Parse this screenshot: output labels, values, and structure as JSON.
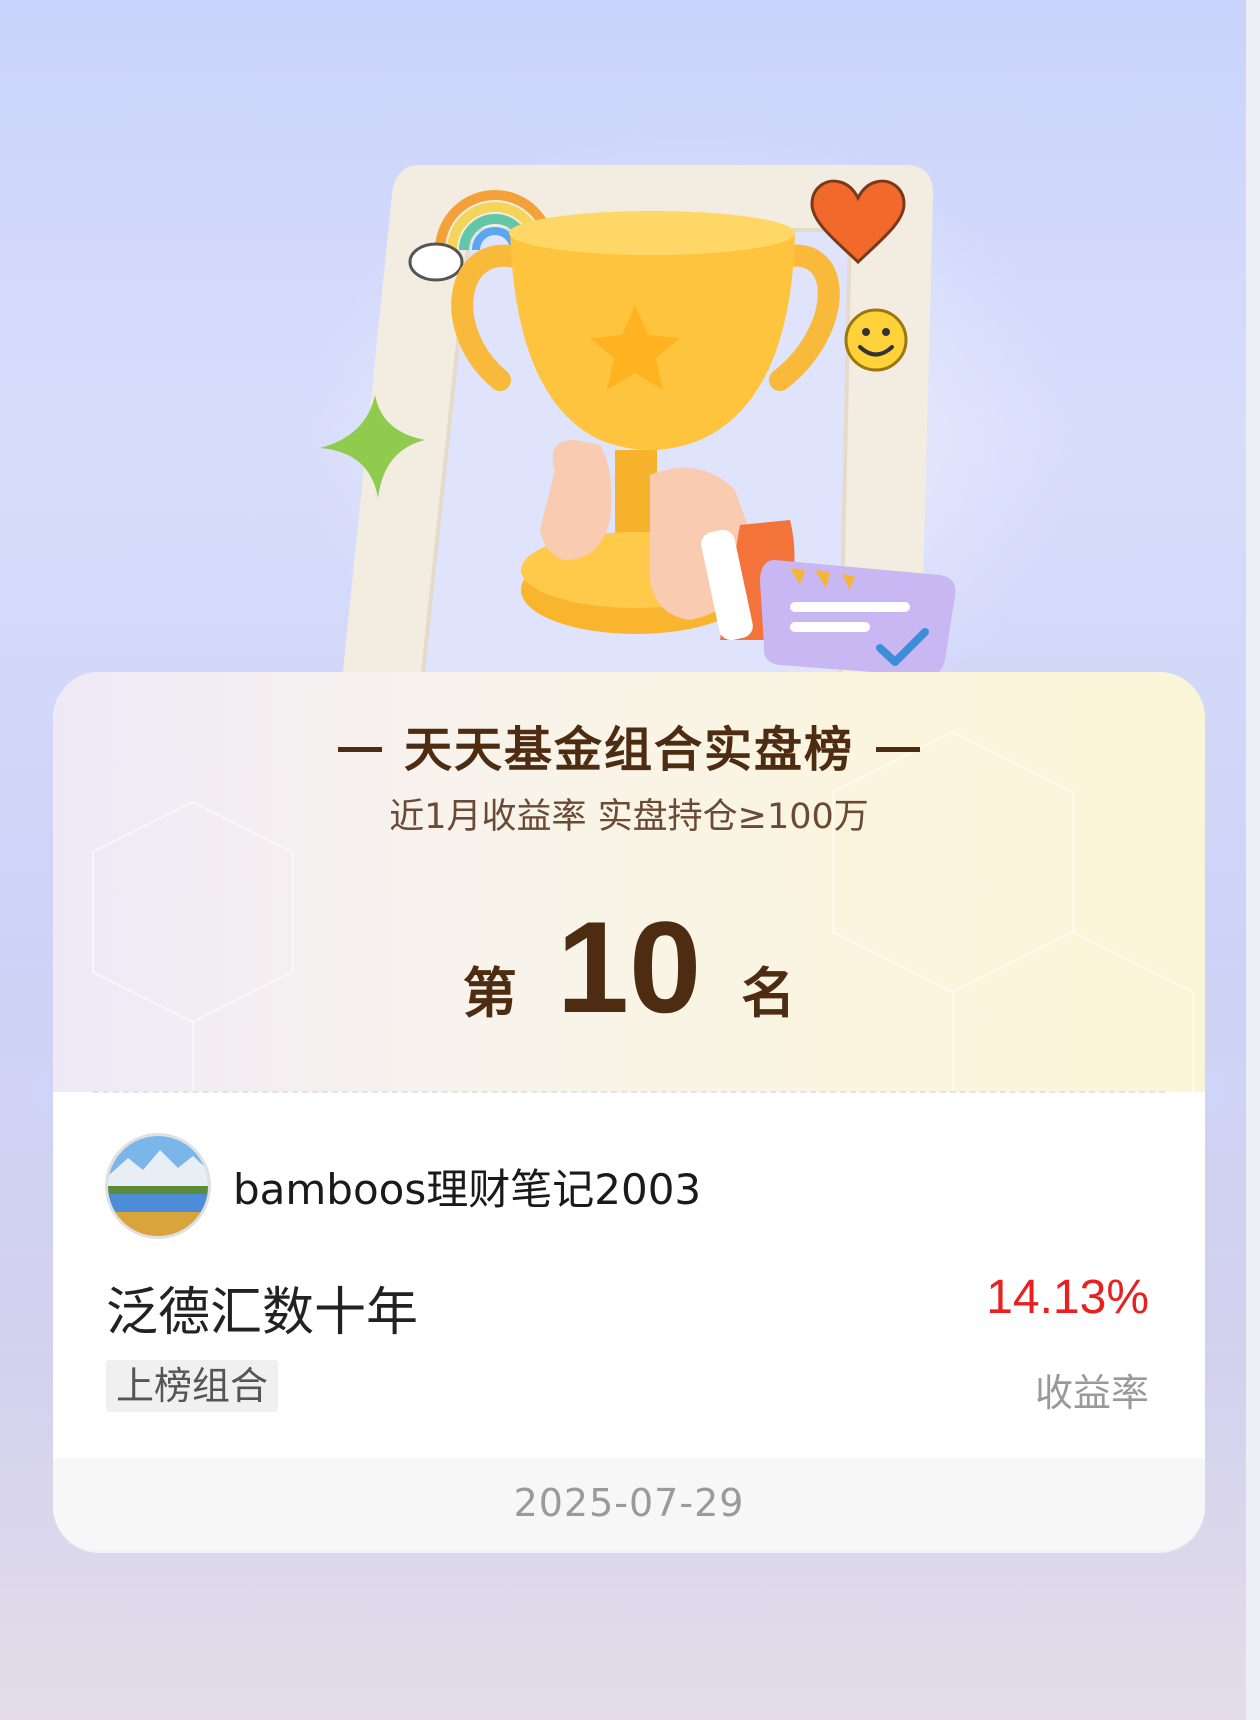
{
  "card": {
    "title": "天天基金组合实盘榜",
    "subtitle": "近1月收益率 实盘持仓≥100万",
    "rank_prefix": "第",
    "rank_number": "10",
    "rank_suffix": "名"
  },
  "user": {
    "name": "bamboos理财笔记2003"
  },
  "fund": {
    "name": "泛德汇数十年",
    "tag": "上榜组合",
    "return_value": "14.13%",
    "return_label": "收益率"
  },
  "footer": {
    "date": "2025-07-29"
  },
  "colors": {
    "title": "#4e2c12",
    "return": "#e8201f",
    "trophy": "#ffc43d",
    "heart": "#f26a2b"
  },
  "icons": [
    "trophy-icon",
    "rainbow-icon",
    "heart-icon",
    "smiley-icon",
    "sparkle-icon",
    "rating-card-icon",
    "avatar-landscape-image"
  ]
}
